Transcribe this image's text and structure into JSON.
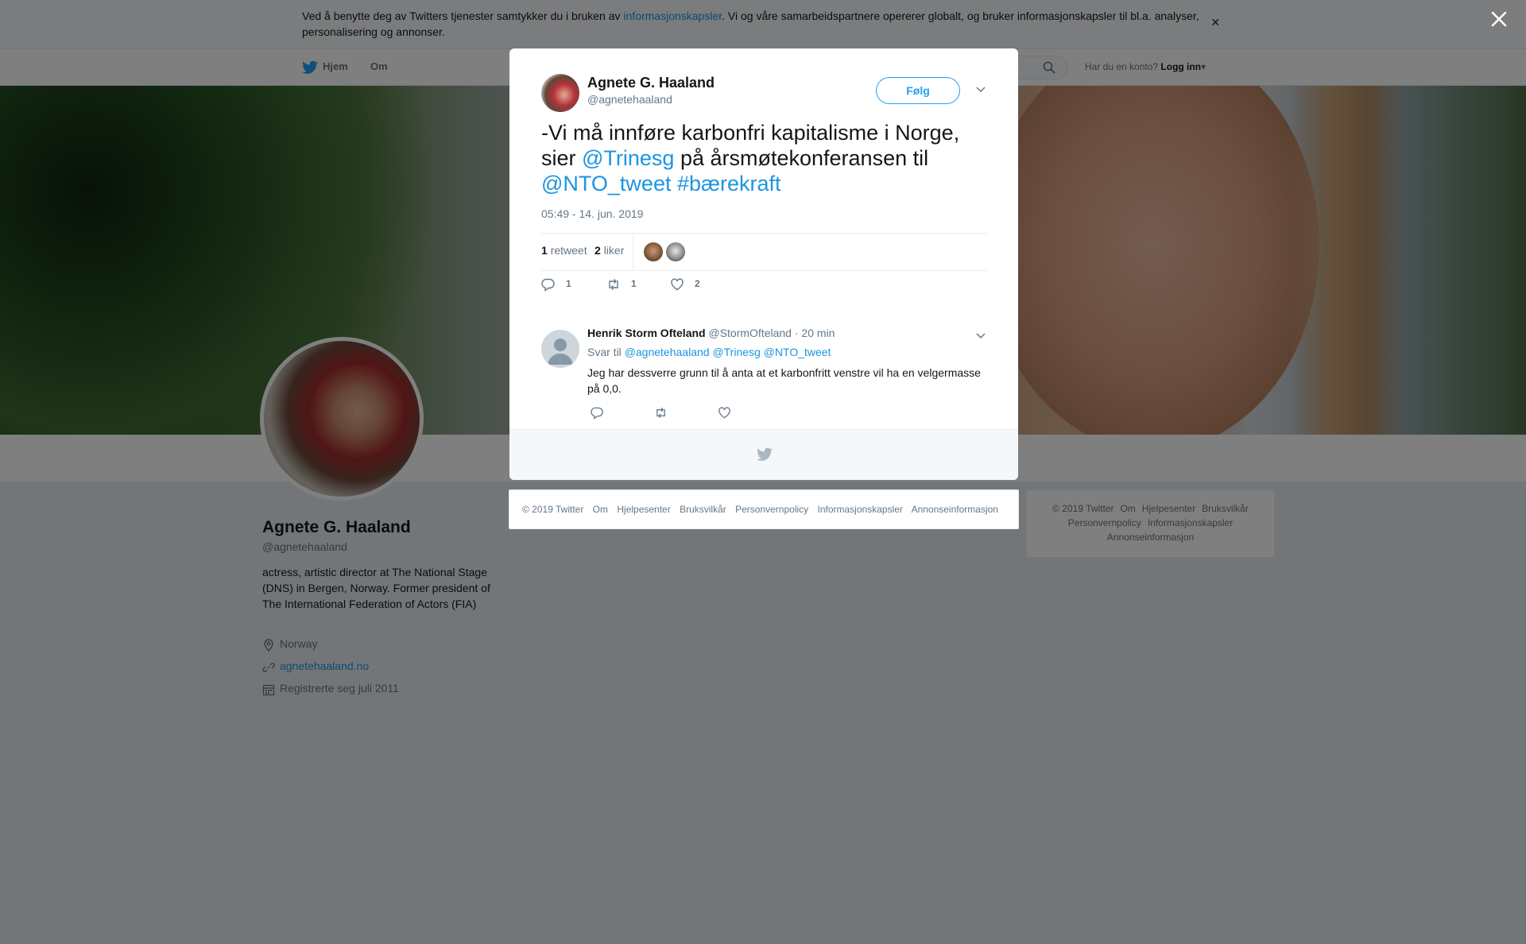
{
  "cookie_bar": {
    "text_before": "Ved å benytte deg av Twitters tjenester samtykker du i bruken av ",
    "link": "informasjonskapsler",
    "text_after": ". Vi og våre samarbeidspartnere opererer globalt, og bruker informasjonskapsler til bl.a. analyser, personalisering og annonser.",
    "close": "×"
  },
  "nav": {
    "home": "Hjem",
    "about": "Om",
    "account_question": "Har du en konto?",
    "login": "Logg inn"
  },
  "profile": {
    "name": "Agnete G. Haaland",
    "handle": "@agnetehaaland",
    "bio": "actress, artistic director at The National Stage (DNS) in Bergen, Norway. Former president of The International Federation of Actors (FIA)",
    "location": "Norway",
    "website": "agnetehaaland.no",
    "joined": "Registrerte seg juli 2011"
  },
  "tweet": {
    "author_name": "Agnete G. Haaland",
    "author_handle": "@agnetehaaland",
    "follow_label": "Følg",
    "text_1": "-Vi må innføre karbonfri kapitalisme i Norge, sier ",
    "mention_1": "@Trinesg",
    "text_2": " på årsmøtekonferansen til ",
    "mention_2": "@NTO_tweet",
    "text_3": " ",
    "hashtag": "#bærekraft",
    "timestamp": "05:49 - 14. jun. 2019",
    "retweet_count": "1",
    "retweet_label": "retweet",
    "like_count": "2",
    "like_label": "liker",
    "action_reply_count": "1",
    "action_retweet_count": "1",
    "action_like_count": "2"
  },
  "reply": {
    "author_name": "Henrik Storm Ofteland",
    "author_handle": "@StormOfteland",
    "time": "· 20 min",
    "reply_to_label": "Svar til",
    "reply_to_1": "@agnetehaaland",
    "reply_to_2": "@Trinesg",
    "reply_to_3": "@NTO_tweet",
    "text": "Jeg har dessverre grunn til å anta at et karbonfritt venstre vil ha en velgermasse på 0,0."
  },
  "footer_links": [
    "© 2019 Twitter",
    "Om",
    "Hjelpesenter",
    "Bruksvilkår",
    "Personvernpolicy",
    "Informasjonskapsler",
    "Annonseinformasjon"
  ],
  "colors": {
    "link": "#1b95e0",
    "twitter_blue": "#1da1f2",
    "muted": "#657786"
  },
  "icons": [
    "twitter-bird-icon",
    "search-icon",
    "close-icon",
    "chevron-down-icon",
    "reply-icon",
    "retweet-icon",
    "like-icon",
    "location-icon",
    "link-icon",
    "calendar-icon"
  ]
}
